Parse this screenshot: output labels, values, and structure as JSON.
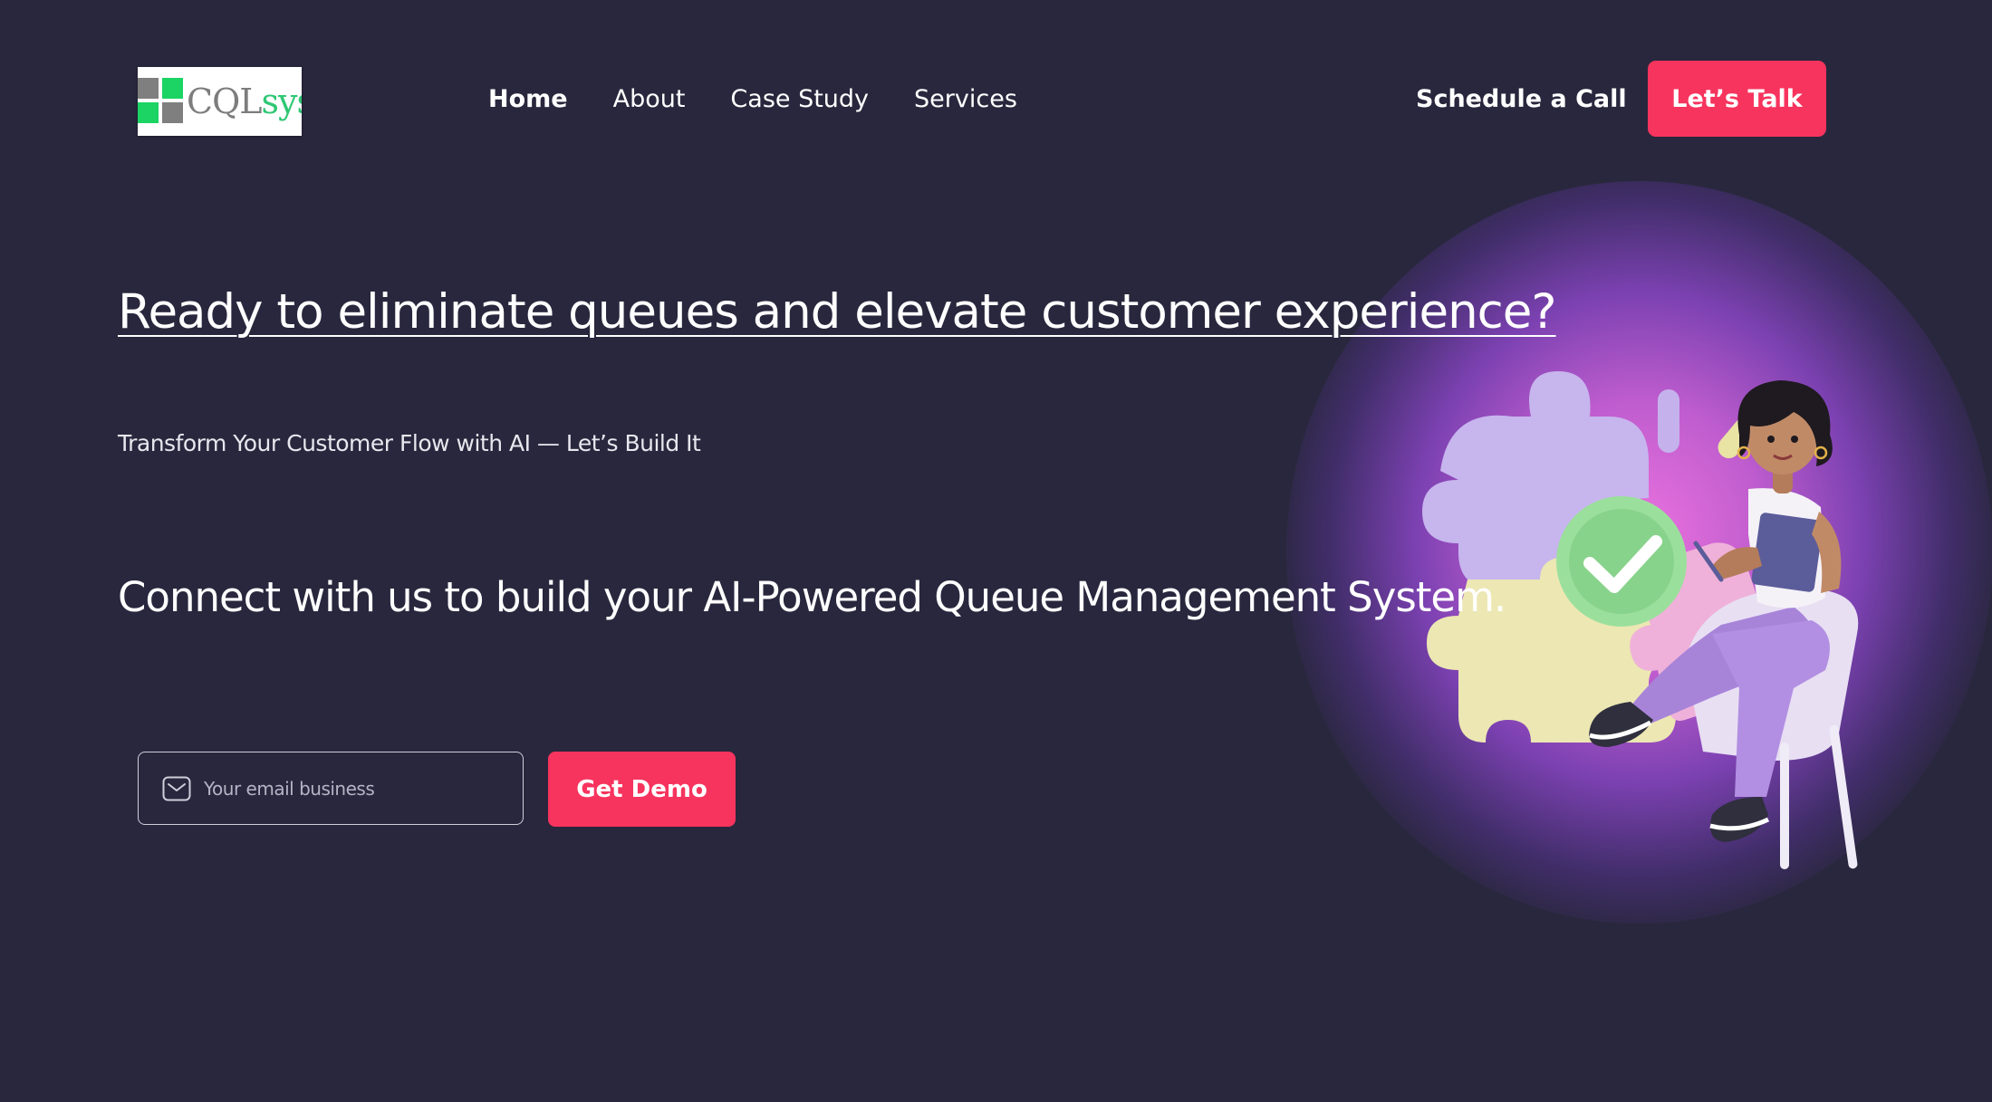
{
  "header": {
    "logo": {
      "text_main": "CQL",
      "text_accent": "sys"
    },
    "nav": [
      {
        "label": "Home",
        "active": true
      },
      {
        "label": "About",
        "active": false
      },
      {
        "label": "Case Study",
        "active": false
      },
      {
        "label": "Services",
        "active": false
      }
    ],
    "schedule_label": "Schedule a Call",
    "cta_label": "Let’s Talk"
  },
  "hero": {
    "headline": "Ready to eliminate queues and elevate customer experience?",
    "subheadline": "Transform Your Customer Flow with AI — Let’s Build It",
    "connect_text": "Connect with us to build your AI-Powered Queue Management System.",
    "email_placeholder": "Your email business",
    "demo_label": "Get Demo"
  },
  "colors": {
    "background": "#29273d",
    "accent": "#f7345e",
    "logo_green": "#1bd464",
    "logo_gray": "#7f7f7f"
  },
  "icons": {
    "email": "mail-icon",
    "illustration": "woman-with-puzzle-pieces-illustration"
  }
}
